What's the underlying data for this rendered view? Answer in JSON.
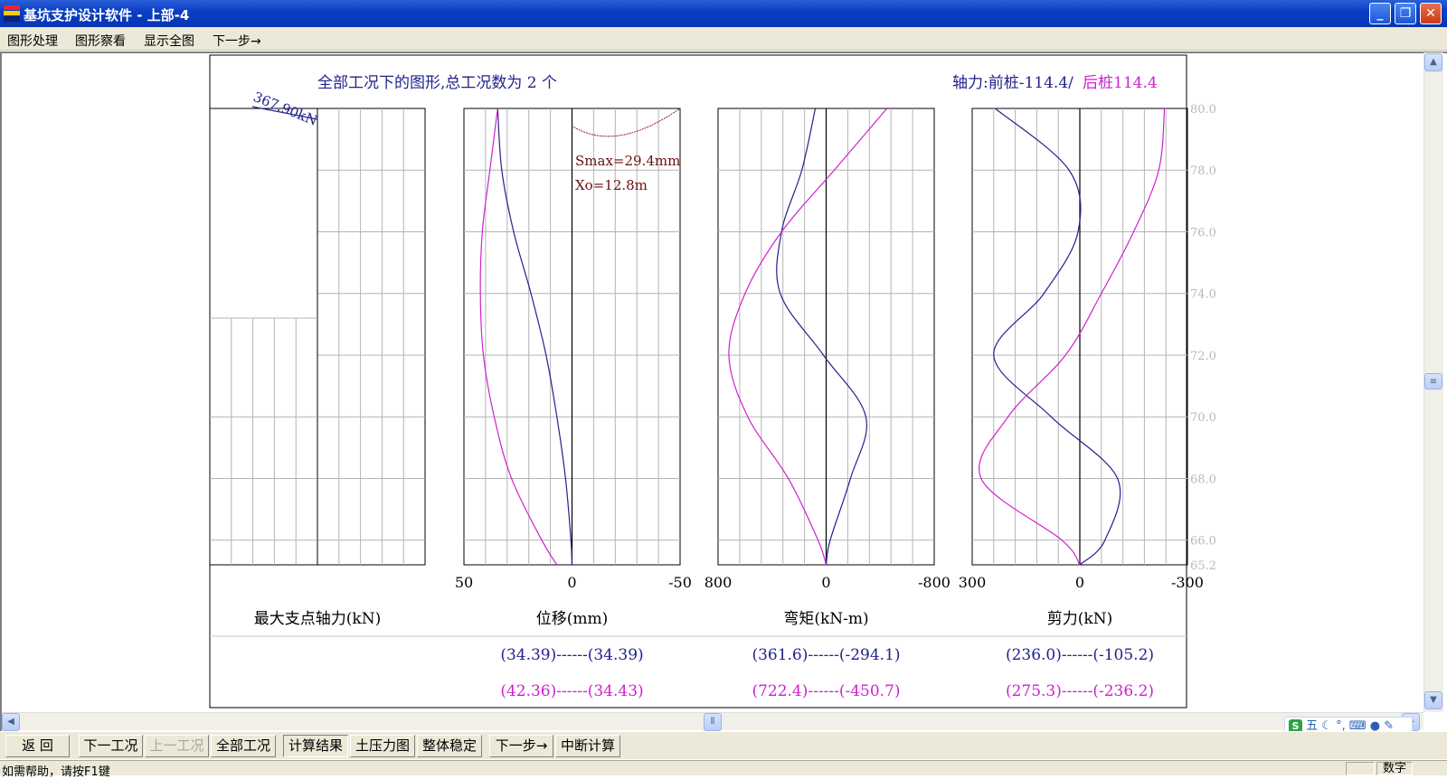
{
  "window": {
    "title": "基坑支护设计软件 - 上部-4"
  },
  "menu": [
    "图形处理",
    "图形察看",
    "显示全图",
    "下一步→"
  ],
  "chart": {
    "title": "全部工况下的图形,总工况数为 2 个",
    "axial_prefix": "轴力:前桩-114.4/",
    "axial_back": "后桩114.4",
    "anchor_label": "367.90kN",
    "smax": "Smax=29.4mm",
    "xo": "Xo=12.8m",
    "depth_ticks": [
      "80.0",
      "78.0",
      "76.0",
      "74.0",
      "72.0",
      "70.0",
      "68.0",
      "66.0",
      "65.2"
    ],
    "panels": [
      {
        "label": "最大支点轴力(kN)",
        "ticks": [
          "",
          "",
          ""
        ],
        "r1": "",
        "r2": ""
      },
      {
        "label": "位移(mm)",
        "ticks": [
          "50",
          "0",
          "-50"
        ],
        "r1": "(34.39)------(34.39)",
        "r2": "(42.36)------(34.43)"
      },
      {
        "label": "弯矩(kN-m)",
        "ticks": [
          "800",
          "0",
          "-800"
        ],
        "r1": "(361.6)------(-294.1)",
        "r2": "(722.4)------(-450.7)"
      },
      {
        "label": "剪力(kN)",
        "ticks": [
          "300",
          "0",
          "-300"
        ],
        "r1": "(236.0)------(-105.2)",
        "r2": "(275.3)------(-236.2)"
      }
    ]
  },
  "chart_data": [
    {
      "type": "line",
      "title": "位移(mm)",
      "y": [
        80.0,
        78.0,
        76.0,
        74.0,
        72.0,
        70.0,
        68.0,
        66.0,
        65.2
      ],
      "series": [
        {
          "name": "",
          "color": "#22228c",
          "x": [
            34.4,
            32.5,
            27.0,
            19.0,
            12.0,
            7.0,
            3.0,
            0.5,
            0.0
          ]
        },
        {
          "name": "",
          "color": "#d020d0",
          "x": [
            34.4,
            38.0,
            41.5,
            42.4,
            41.0,
            36.0,
            28.0,
            14.0,
            7.0
          ]
        }
      ],
      "xlim": [
        50,
        -50
      ]
    },
    {
      "type": "line",
      "title": "弯矩(kN-m)",
      "y": [
        80.0,
        78.0,
        76.0,
        74.0,
        72.0,
        70.0,
        68.0,
        66.0,
        65.2
      ],
      "series": [
        {
          "name": "",
          "color": "#22228c",
          "x": [
            80,
            180,
            330,
            340,
            20,
            -294,
            -180,
            -30,
            0
          ]
        },
        {
          "name": "",
          "color": "#d020d0",
          "x": [
            -450,
            -60,
            330,
            600,
            720,
            580,
            280,
            60,
            0
          ]
        }
      ],
      "xlim": [
        800,
        -800
      ]
    },
    {
      "type": "line",
      "title": "剪力(kN)",
      "y": [
        80.0,
        78.0,
        76.0,
        74.0,
        72.0,
        70.0,
        68.0,
        66.0,
        65.2
      ],
      "series": [
        {
          "name": "",
          "color": "#22228c",
          "x": [
            236,
            30,
            5,
            100,
            240,
            80,
            -105,
            -70,
            0
          ]
        },
        {
          "name": "",
          "color": "#d020d0",
          "x": [
            -236,
            -220,
            -150,
            -60,
            40,
            200,
            275,
            50,
            0
          ]
        }
      ],
      "xlim": [
        300,
        -300
      ]
    }
  ],
  "toolbar": [
    {
      "label": "返  回",
      "state": "normal"
    },
    {
      "label": "下一工况",
      "state": "normal"
    },
    {
      "label": "上一工况",
      "state": "disabled"
    },
    {
      "label": "全部工况",
      "state": "normal"
    },
    {
      "label": "计算结果",
      "state": "pressed"
    },
    {
      "label": "土压力图",
      "state": "normal"
    },
    {
      "label": "整体稳定",
      "state": "normal"
    },
    {
      "label": "下一步→",
      "state": "normal"
    },
    {
      "label": "中断计算",
      "state": "normal"
    }
  ],
  "status": {
    "help": "如需帮助，请按F1键",
    "numlock": "数字"
  },
  "ime": {
    "mode": "五"
  }
}
